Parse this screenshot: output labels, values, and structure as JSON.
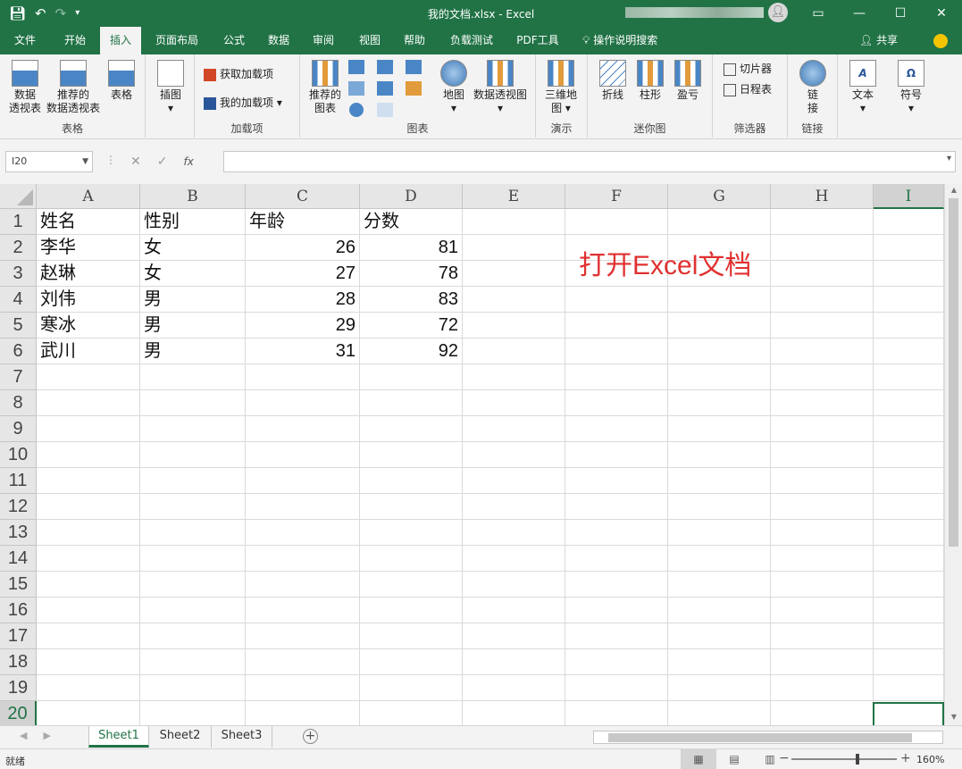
{
  "window": {
    "title": "我的文档.xlsx  -  Excel",
    "qat": [
      "save-icon",
      "undo-icon",
      "redo-icon",
      "customize-icon"
    ],
    "controls": [
      "ribbon-display-icon",
      "minimize-icon",
      "maximize-icon",
      "close-icon"
    ]
  },
  "tabs": [
    "文件",
    "开始",
    "插入",
    "页面布局",
    "公式",
    "数据",
    "审阅",
    "视图",
    "帮助",
    "负载测试",
    "PDF工具"
  ],
  "active_tab": "插入",
  "tell_me": "操作说明搜索",
  "share": "共享",
  "ribbon": {
    "tables": {
      "label": "表格",
      "pivot": "数据\n透视表",
      "recommended_pivot": "推荐的\n数据透视表",
      "table": "表格"
    },
    "illustrations": {
      "label": "插图"
    },
    "addins": {
      "label": "加载项",
      "get": "获取加载项",
      "my": "我的加载项"
    },
    "charts": {
      "label": "图表",
      "recommended": "推荐的\n图表",
      "map": "地图",
      "pivotchart": "数据透视图"
    },
    "tours": {
      "label": "演示",
      "map3d": "三维地\n图"
    },
    "sparklines": {
      "label": "迷你图",
      "line": "折线",
      "column": "柱形",
      "winloss": "盈亏"
    },
    "filters": {
      "label": "筛选器",
      "slicer": "切片器",
      "timeline": "日程表"
    },
    "links": {
      "label": "链接",
      "link": "链\n接"
    },
    "text": {
      "label": "文本"
    },
    "symbols": {
      "label": "符号"
    }
  },
  "formula_bar": {
    "name_box": "I20",
    "cancel": "✕",
    "enter": "✓",
    "fx": "fx",
    "value": ""
  },
  "columns": [
    "A",
    "B",
    "C",
    "D",
    "E",
    "F",
    "G",
    "H",
    "I"
  ],
  "rows": [
    "1",
    "2",
    "3",
    "4",
    "5",
    "6",
    "7",
    "8",
    "9",
    "10",
    "11",
    "12",
    "13",
    "14",
    "15",
    "16",
    "17",
    "18",
    "19",
    "20"
  ],
  "cells": {
    "header": [
      "姓名",
      "性别",
      "年龄",
      "分数"
    ],
    "data": [
      [
        "李华",
        "女",
        "26",
        "81"
      ],
      [
        "赵琳",
        "女",
        "27",
        "78"
      ],
      [
        "刘伟",
        "男",
        "28",
        "83"
      ],
      [
        "寒冰",
        "男",
        "29",
        "72"
      ],
      [
        "武川",
        "男",
        "31",
        "92"
      ]
    ]
  },
  "annotation": "打开Excel文档",
  "sheets": [
    "Sheet1",
    "Sheet2",
    "Sheet3"
  ],
  "active_sheet": "Sheet1",
  "status": {
    "ready": "就绪",
    "zoom": "160%"
  },
  "colors": {
    "accent": "#217346",
    "annotation": "#e03030"
  }
}
